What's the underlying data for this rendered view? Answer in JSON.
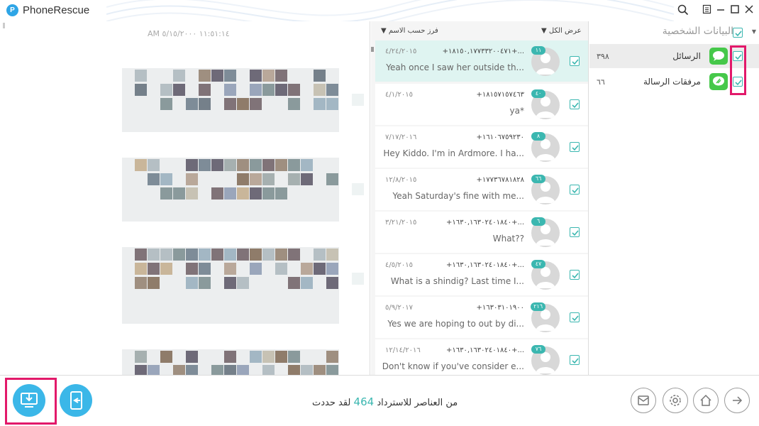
{
  "app": {
    "title": "PhoneRescue",
    "logo_letter": "P"
  },
  "preview": {
    "timestamp": "AM ١١:٥١:١٤ ٥/١٥/٢٠٠٠"
  },
  "list": {
    "header_filter": "عرض الكل",
    "header_sort": "فرز حسب الاسم",
    "rows": [
      {
        "date": "٤/٢٤/٢٠١٥",
        "number": "+١٨١٥٠,١٧٧٣٣٢٠٠٤٧١+...",
        "text": "Yeah once I saw her outside th...",
        "badge": "١١"
      },
      {
        "date": "٤/١/٢٠١٥",
        "number": "+١٨١٥٧١٥٧٤٦٣",
        "text": "ya*",
        "badge": "٤٠"
      },
      {
        "date": "٧/١٧/٢٠١٦",
        "number": "+١٦١٠٦٧٥٩٢٣٠",
        "text": "Hey Kiddo. I'm in Ardmore. I ha...",
        "badge": "٨"
      },
      {
        "date": "١٢/٨/٢٠١٥",
        "number": "+١٧٧٣٦٧٨١٨٢٨",
        "text": "Yeah Saturday's fine with me...",
        "badge": "٦٦"
      },
      {
        "date": "٣/٢١/٢٠١٥",
        "number": "+١٦٣٠,١٦٣٠٢٤٠١٨٤٠+...",
        "text": "What??",
        "badge": "٦"
      },
      {
        "date": "٤/٥/٢٠١٥",
        "number": "+١٦٣٠,١٦٣٠٢٤٠١٨٤٠+...",
        "text": "What is a shindig? Last time I...",
        "badge": "٤٧"
      },
      {
        "date": "٥/٩/٢٠١٧",
        "number": "+١٦٣٠٣١٠١٩٠٠",
        "text": "Yes we are hoping to out by di...",
        "badge": "٢١٦"
      },
      {
        "date": "١٢/١٤/٢٠١٦",
        "number": "+١٦٣٠,١٦٣٠٢٤٠١٨٤٠+...",
        "text": "Don't know if you've consider e...",
        "badge": "٧٦"
      }
    ]
  },
  "categories": {
    "title": "البيانات الشخصية",
    "items": [
      {
        "name": "الرسائل",
        "count": "٣٩٨"
      },
      {
        "name": "مرفقات الرسالة",
        "count": "٦٦"
      }
    ]
  },
  "status": {
    "prefix": "لقد حددت",
    "count": "464",
    "suffix": "من العناصر للاسترداد"
  },
  "colors": {
    "accent": "#3bb7b0",
    "button_blue": "#3bb7e8",
    "highlight": "#e2196a",
    "message_green": "#46c84a"
  }
}
